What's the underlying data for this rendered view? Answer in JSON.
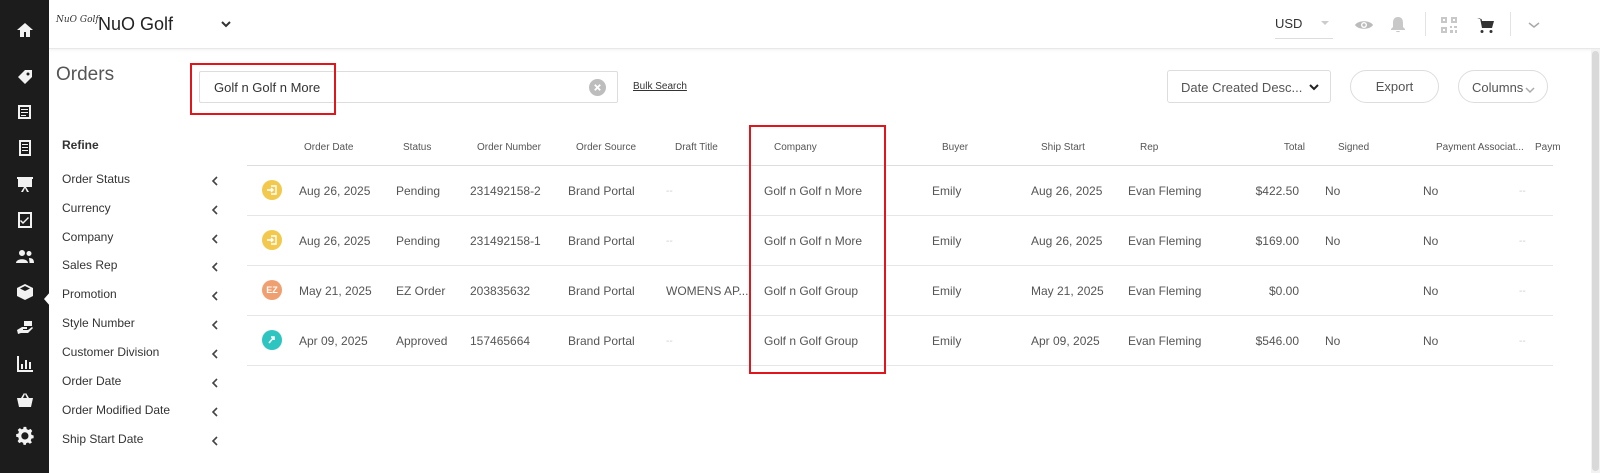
{
  "rail": {
    "icons": [
      "home-icon",
      "tag-icon",
      "catalog-icon",
      "book-icon",
      "presentation-icon",
      "checklist-icon",
      "users-icon",
      "box-icon",
      "hand-money-icon",
      "chart-icon",
      "basket-icon",
      "gear-icon"
    ]
  },
  "header": {
    "logo_text": "NuO Golf",
    "brand": "NuO Golf",
    "currency": "USD"
  },
  "page": {
    "title": "Orders"
  },
  "search": {
    "value": "Golf n Golf n More",
    "bulk_label": "Bulk Search"
  },
  "toolbar": {
    "sort_label": "Date Created Desc...",
    "export_label": "Export",
    "columns_label": "Columns"
  },
  "refine": {
    "title": "Refine",
    "filters": [
      "Order Status",
      "Currency",
      "Company",
      "Sales Rep",
      "Promotion",
      "Style Number",
      "Customer Division",
      "Order Date",
      "Order Modified Date",
      "Ship Start Date"
    ]
  },
  "table": {
    "columns": [
      "Order Date",
      "Status",
      "Order Number",
      "Order Source",
      "Draft Title",
      "Company",
      "Buyer",
      "Ship Start",
      "Rep",
      "Total",
      "Signed",
      "Payment Associat...",
      "Paym"
    ],
    "rows": [
      {
        "icon": "enter-icon",
        "icon_color": "#f2c94c",
        "icon_text": "",
        "date": "Aug 26, 2025",
        "status": "Pending",
        "number": "231492158-2",
        "source": "Brand Portal",
        "draft": "--",
        "company": "Golf n Golf n More",
        "buyer": "Emily",
        "ship": "Aug 26, 2025",
        "rep": "Evan Fleming",
        "total": "$422.50",
        "signed": "No",
        "payment": "No",
        "paym": "--"
      },
      {
        "icon": "enter-icon",
        "icon_color": "#f2c94c",
        "icon_text": "",
        "date": "Aug 26, 2025",
        "status": "Pending",
        "number": "231492158-1",
        "source": "Brand Portal",
        "draft": "--",
        "company": "Golf n Golf n More",
        "buyer": "Emily",
        "ship": "Aug 26, 2025",
        "rep": "Evan Fleming",
        "total": "$169.00",
        "signed": "No",
        "payment": "No",
        "paym": "--"
      },
      {
        "icon": "ez-badge-icon",
        "icon_color": "#f0a070",
        "icon_text": "EZ",
        "date": "May 21, 2025",
        "status": "EZ Order",
        "number": "203835632",
        "source": "Brand Portal",
        "draft": "WOMENS AP...",
        "company": "Golf n Golf Group",
        "buyer": "Emily",
        "ship": "May 21, 2025",
        "rep": "Evan Fleming",
        "total": "$0.00",
        "signed": "",
        "payment": "No",
        "paym": "--"
      },
      {
        "icon": "approved-icon",
        "icon_color": "#2ec4c0",
        "icon_text": "",
        "date": "Apr 09, 2025",
        "status": "Approved",
        "number": "157465664",
        "source": "Brand Portal",
        "draft": "--",
        "company": "Golf n Golf Group",
        "buyer": "Emily",
        "ship": "Apr 09, 2025",
        "rep": "Evan Fleming",
        "total": "$546.00",
        "signed": "No",
        "payment": "No",
        "paym": "--"
      }
    ]
  },
  "colors": {
    "rail_bg": "#1c1c1c",
    "highlight": "#e0161c",
    "pending": "#f2c94c",
    "ez": "#f0a070",
    "approved": "#2ec4c0"
  }
}
